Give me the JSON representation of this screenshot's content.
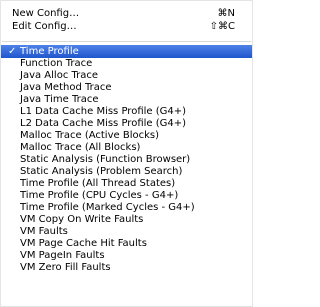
{
  "menu": {
    "header_items": [
      {
        "label": "New Config…",
        "shortcut": "⌘N"
      },
      {
        "label": "Edit Config…",
        "shortcut": "⇧⌘C"
      }
    ],
    "selected_check": "✓",
    "items": [
      {
        "label": "Time Profile",
        "selected": true
      },
      {
        "label": "Function Trace"
      },
      {
        "label": "Java Alloc Trace"
      },
      {
        "label": "Java Method Trace"
      },
      {
        "label": "Java Time Trace"
      },
      {
        "label": "L1 Data Cache Miss Profile (G4+)"
      },
      {
        "label": "L2 Data Cache Miss Profile (G4+)"
      },
      {
        "label": "Malloc Trace (Active Blocks)"
      },
      {
        "label": "Malloc Trace (All Blocks)"
      },
      {
        "label": "Static Analysis (Function Browser)"
      },
      {
        "label": "Static Analysis (Problem Search)"
      },
      {
        "label": "Time Profile (All Thread States)"
      },
      {
        "label": "Time Profile (CPU Cycles - G4+)"
      },
      {
        "label": "Time Profile (Marked Cycles - G4+)"
      },
      {
        "label": "VM Copy On Write Faults"
      },
      {
        "label": "VM Faults"
      },
      {
        "label": "VM Page Cache Hit Faults"
      },
      {
        "label": "VM PageIn Faults"
      },
      {
        "label": "VM Zero Fill Faults"
      }
    ],
    "colors": {
      "highlight": "#2f63d4",
      "highlight_text": "#ffffff",
      "text": "#000000",
      "separator": "#d9d9d9"
    }
  }
}
